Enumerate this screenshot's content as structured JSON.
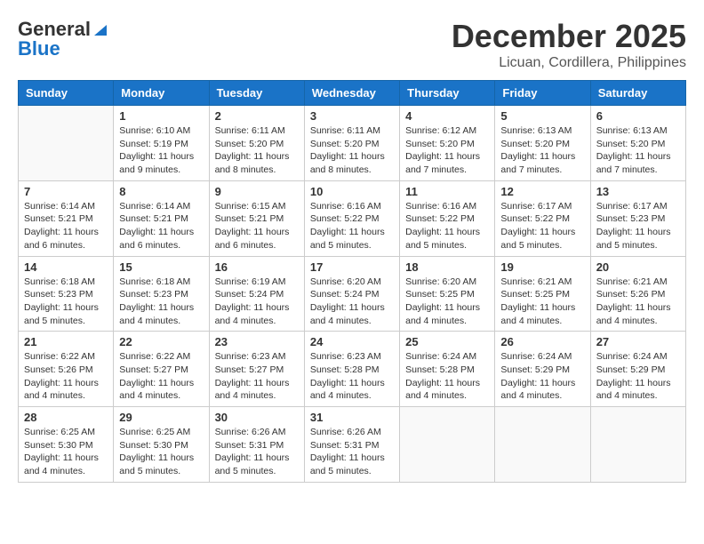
{
  "header": {
    "logo_general": "General",
    "logo_blue": "Blue",
    "month": "December 2025",
    "location": "Licuan, Cordillera, Philippines"
  },
  "weekdays": [
    "Sunday",
    "Monday",
    "Tuesday",
    "Wednesday",
    "Thursday",
    "Friday",
    "Saturday"
  ],
  "weeks": [
    [
      {
        "day": "",
        "info": ""
      },
      {
        "day": "1",
        "info": "Sunrise: 6:10 AM\nSunset: 5:19 PM\nDaylight: 11 hours\nand 9 minutes."
      },
      {
        "day": "2",
        "info": "Sunrise: 6:11 AM\nSunset: 5:20 PM\nDaylight: 11 hours\nand 8 minutes."
      },
      {
        "day": "3",
        "info": "Sunrise: 6:11 AM\nSunset: 5:20 PM\nDaylight: 11 hours\nand 8 minutes."
      },
      {
        "day": "4",
        "info": "Sunrise: 6:12 AM\nSunset: 5:20 PM\nDaylight: 11 hours\nand 7 minutes."
      },
      {
        "day": "5",
        "info": "Sunrise: 6:13 AM\nSunset: 5:20 PM\nDaylight: 11 hours\nand 7 minutes."
      },
      {
        "day": "6",
        "info": "Sunrise: 6:13 AM\nSunset: 5:20 PM\nDaylight: 11 hours\nand 7 minutes."
      }
    ],
    [
      {
        "day": "7",
        "info": "Sunrise: 6:14 AM\nSunset: 5:21 PM\nDaylight: 11 hours\nand 6 minutes."
      },
      {
        "day": "8",
        "info": "Sunrise: 6:14 AM\nSunset: 5:21 PM\nDaylight: 11 hours\nand 6 minutes."
      },
      {
        "day": "9",
        "info": "Sunrise: 6:15 AM\nSunset: 5:21 PM\nDaylight: 11 hours\nand 6 minutes."
      },
      {
        "day": "10",
        "info": "Sunrise: 6:16 AM\nSunset: 5:22 PM\nDaylight: 11 hours\nand 5 minutes."
      },
      {
        "day": "11",
        "info": "Sunrise: 6:16 AM\nSunset: 5:22 PM\nDaylight: 11 hours\nand 5 minutes."
      },
      {
        "day": "12",
        "info": "Sunrise: 6:17 AM\nSunset: 5:22 PM\nDaylight: 11 hours\nand 5 minutes."
      },
      {
        "day": "13",
        "info": "Sunrise: 6:17 AM\nSunset: 5:23 PM\nDaylight: 11 hours\nand 5 minutes."
      }
    ],
    [
      {
        "day": "14",
        "info": "Sunrise: 6:18 AM\nSunset: 5:23 PM\nDaylight: 11 hours\nand 5 minutes."
      },
      {
        "day": "15",
        "info": "Sunrise: 6:18 AM\nSunset: 5:23 PM\nDaylight: 11 hours\nand 4 minutes."
      },
      {
        "day": "16",
        "info": "Sunrise: 6:19 AM\nSunset: 5:24 PM\nDaylight: 11 hours\nand 4 minutes."
      },
      {
        "day": "17",
        "info": "Sunrise: 6:20 AM\nSunset: 5:24 PM\nDaylight: 11 hours\nand 4 minutes."
      },
      {
        "day": "18",
        "info": "Sunrise: 6:20 AM\nSunset: 5:25 PM\nDaylight: 11 hours\nand 4 minutes."
      },
      {
        "day": "19",
        "info": "Sunrise: 6:21 AM\nSunset: 5:25 PM\nDaylight: 11 hours\nand 4 minutes."
      },
      {
        "day": "20",
        "info": "Sunrise: 6:21 AM\nSunset: 5:26 PM\nDaylight: 11 hours\nand 4 minutes."
      }
    ],
    [
      {
        "day": "21",
        "info": "Sunrise: 6:22 AM\nSunset: 5:26 PM\nDaylight: 11 hours\nand 4 minutes."
      },
      {
        "day": "22",
        "info": "Sunrise: 6:22 AM\nSunset: 5:27 PM\nDaylight: 11 hours\nand 4 minutes."
      },
      {
        "day": "23",
        "info": "Sunrise: 6:23 AM\nSunset: 5:27 PM\nDaylight: 11 hours\nand 4 minutes."
      },
      {
        "day": "24",
        "info": "Sunrise: 6:23 AM\nSunset: 5:28 PM\nDaylight: 11 hours\nand 4 minutes."
      },
      {
        "day": "25",
        "info": "Sunrise: 6:24 AM\nSunset: 5:28 PM\nDaylight: 11 hours\nand 4 minutes."
      },
      {
        "day": "26",
        "info": "Sunrise: 6:24 AM\nSunset: 5:29 PM\nDaylight: 11 hours\nand 4 minutes."
      },
      {
        "day": "27",
        "info": "Sunrise: 6:24 AM\nSunset: 5:29 PM\nDaylight: 11 hours\nand 4 minutes."
      }
    ],
    [
      {
        "day": "28",
        "info": "Sunrise: 6:25 AM\nSunset: 5:30 PM\nDaylight: 11 hours\nand 4 minutes."
      },
      {
        "day": "29",
        "info": "Sunrise: 6:25 AM\nSunset: 5:30 PM\nDaylight: 11 hours\nand 5 minutes."
      },
      {
        "day": "30",
        "info": "Sunrise: 6:26 AM\nSunset: 5:31 PM\nDaylight: 11 hours\nand 5 minutes."
      },
      {
        "day": "31",
        "info": "Sunrise: 6:26 AM\nSunset: 5:31 PM\nDaylight: 11 hours\nand 5 minutes."
      },
      {
        "day": "",
        "info": ""
      },
      {
        "day": "",
        "info": ""
      },
      {
        "day": "",
        "info": ""
      }
    ]
  ]
}
